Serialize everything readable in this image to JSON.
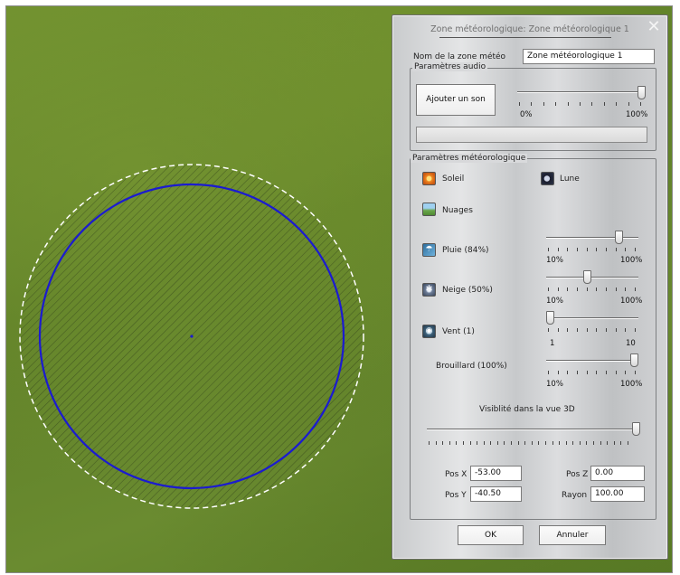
{
  "dialog": {
    "title": "Zone météorologique: Zone météorologique 1",
    "name_label": "Nom de la zone météo",
    "name_value": "Zone météorologique 1",
    "close_symbol": "✕"
  },
  "audio": {
    "group_title": "Paramètres audio",
    "add_sound_label": "Ajouter un son",
    "volume": {
      "value_percent": 100,
      "min_label": "0%",
      "max_label": "100%"
    },
    "sound_file_value": ""
  },
  "weather": {
    "group_title": "Paramètres météorologique",
    "sun_label": "Soleil",
    "moon_label": "Lune",
    "clouds_label": "Nuages",
    "rain": {
      "label": "Pluie (84%)",
      "value_percent": 84,
      "min_label": "10%",
      "max_label": "100%"
    },
    "snow": {
      "label": "Neige (50%)",
      "value_percent": 50,
      "min_label": "10%",
      "max_label": "100%"
    },
    "wind": {
      "label": "Vent (1)",
      "value": 1,
      "min_label": "1",
      "max_label": "10"
    },
    "fog": {
      "label": "Brouillard (100%)",
      "value_percent": 100,
      "min_label": "10%",
      "max_label": "100%"
    },
    "visibility": {
      "label": "Visiblité dans la vue 3D",
      "value_percent": 100
    }
  },
  "position": {
    "pos_x_label": "Pos X",
    "pos_x_value": "-53.00",
    "pos_y_label": "Pos Y",
    "pos_y_value": "-40.50",
    "pos_z_label": "Pos Z",
    "pos_z_value": "0.00",
    "radius_label": "Rayon",
    "radius_value": "100.00"
  },
  "buttons": {
    "ok_label": "OK",
    "cancel_label": "Annuler"
  },
  "colors": {
    "zone_circle": "#1b1bd0",
    "terrain": "#6a8b30"
  },
  "icons": {
    "sun": "sun-icon",
    "moon": "moon-icon",
    "clouds": "clouds-icon",
    "rain": "rain-icon",
    "snow": "snow-icon",
    "wind": "wind-icon",
    "close": "close-icon"
  }
}
